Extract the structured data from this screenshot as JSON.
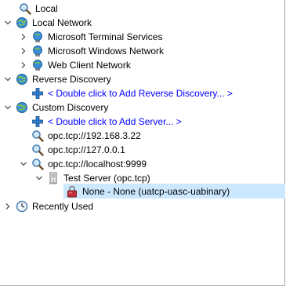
{
  "tree": {
    "local": {
      "label": "Local"
    },
    "local_network": {
      "label": "Local Network",
      "children": [
        {
          "label": "Microsoft Terminal Services"
        },
        {
          "label": "Microsoft Windows Network"
        },
        {
          "label": "Web Client Network"
        }
      ]
    },
    "reverse_discovery": {
      "label": "Reverse Discovery",
      "add_label": "< Double click to Add Reverse Discovery... >"
    },
    "custom_discovery": {
      "label": "Custom Discovery",
      "add_label": "< Double click to Add Server... >",
      "servers": [
        {
          "label": "opc.tcp://192.168.3.22"
        },
        {
          "label": "opc.tcp://127.0.0.1"
        },
        {
          "label": "opc.tcp://localhost:9999"
        }
      ],
      "test_server": {
        "label": "Test Server (opc.tcp)"
      },
      "endpoint": {
        "label": "None - None (uatcp-uasc-uabinary)"
      }
    },
    "recently_used": {
      "label": "Recently Used"
    }
  },
  "colors": {
    "selection": "#cce8ff",
    "link_blue": "#0000ff",
    "chevron": "#555555"
  }
}
